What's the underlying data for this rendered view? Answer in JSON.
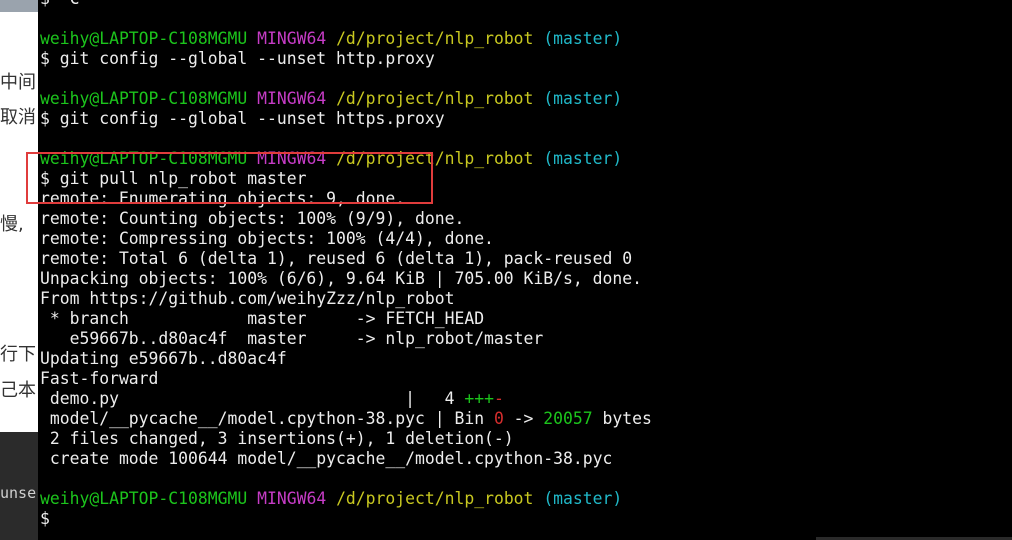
{
  "background_page": {
    "fragments": [
      "中间",
      "取消",
      "慢,",
      "行下",
      "己本"
    ],
    "dark_fragment": "unse"
  },
  "terminal": {
    "first_line": "$ ^C",
    "prompt": {
      "user_host": "weihy@LAPTOP-C108MGMU",
      "env": "MINGW64",
      "path": "/d/project/nlp_robot",
      "branch": "(master)"
    },
    "commands": [
      "$ git config --global --unset http.proxy",
      "$ git config --global --unset https.proxy",
      "$ git pull nlp_robot master"
    ],
    "output": [
      "remote: Enumerating objects: 9, done.",
      "remote: Counting objects: 100% (9/9), done.",
      "remote: Compressing objects: 100% (4/4), done.",
      "remote: Total 6 (delta 1), reused 6 (delta 1), pack-reused 0",
      "Unpacking objects: 100% (6/6), 9.64 KiB | 705.00 KiB/s, done.",
      "From https://github.com/weihyZzz/nlp_robot",
      " * branch            master     -> FETCH_HEAD",
      "   e59667b..d80ac4f  master     -> nlp_robot/master",
      "Updating e59667b..d80ac4f",
      "Fast-forward"
    ],
    "diffstat": {
      "file1": " demo.py                             |   4 ",
      "file1_plus": "+++",
      "file1_minus": "-",
      "file2_pre": " model/__pycache__/model.cpython-38.pyc | Bin ",
      "file2_old": "0",
      "file2_arrow": " -> ",
      "file2_new": "20057",
      "file2_unit": " bytes",
      "summary": " 2 files changed, 3 insertions(+), 1 deletion(-)",
      "create": " create mode 100644 model/__pycache__/model.cpython-38.pyc"
    },
    "final_prompt": "$ "
  },
  "colors": {
    "prompt_user": "#1cc41c",
    "prompt_env": "#c63cc6",
    "prompt_path": "#c8c820",
    "prompt_branch": "#20b8c8",
    "annotation": "#e03c3c"
  }
}
